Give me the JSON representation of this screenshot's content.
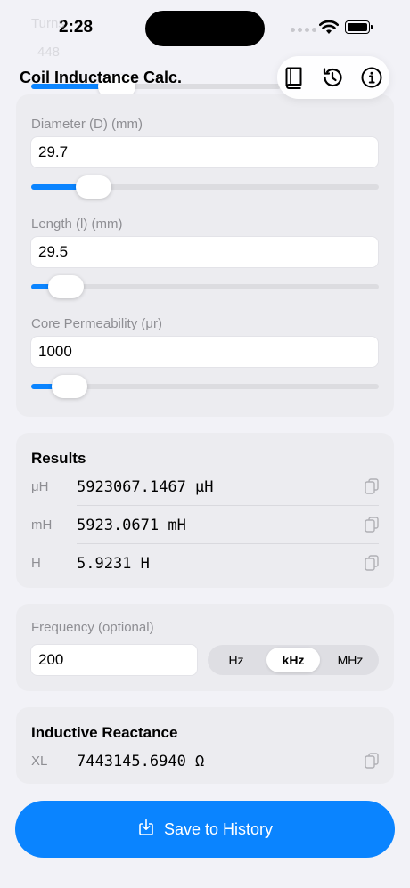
{
  "status": {
    "time": "2:28"
  },
  "ghost": {
    "label": "Turns",
    "value": "448"
  },
  "nav": {
    "title": "Coil Inductance Calc."
  },
  "inputs": {
    "diameter": {
      "label": "Diameter (D) (mm)",
      "value": "29.7",
      "slider_fraction": 0.18
    },
    "length": {
      "label": "Length (l) (mm)",
      "value": "29.5",
      "slider_fraction": 0.1
    },
    "permeability": {
      "label": "Core Permeability (μr)",
      "value": "1000",
      "slider_fraction": 0.11
    }
  },
  "results": {
    "title": "Results",
    "rows": [
      {
        "unit": "μH",
        "value": "5923067.1467 μH"
      },
      {
        "unit": "mH",
        "value": "5923.0671 mH"
      },
      {
        "unit": "H",
        "value": "5.9231 H"
      }
    ]
  },
  "frequency": {
    "label": "Frequency (optional)",
    "value": "200",
    "options": [
      "Hz",
      "kHz",
      "MHz"
    ],
    "selected": "kHz"
  },
  "reactance": {
    "title": "Inductive Reactance",
    "unit": "XL",
    "value": "7443145.6940 Ω"
  },
  "save": {
    "label": "Save to History"
  },
  "colors": {
    "accent": "#0a84ff",
    "background": "#f2f2f7",
    "card": "#ffffff"
  }
}
